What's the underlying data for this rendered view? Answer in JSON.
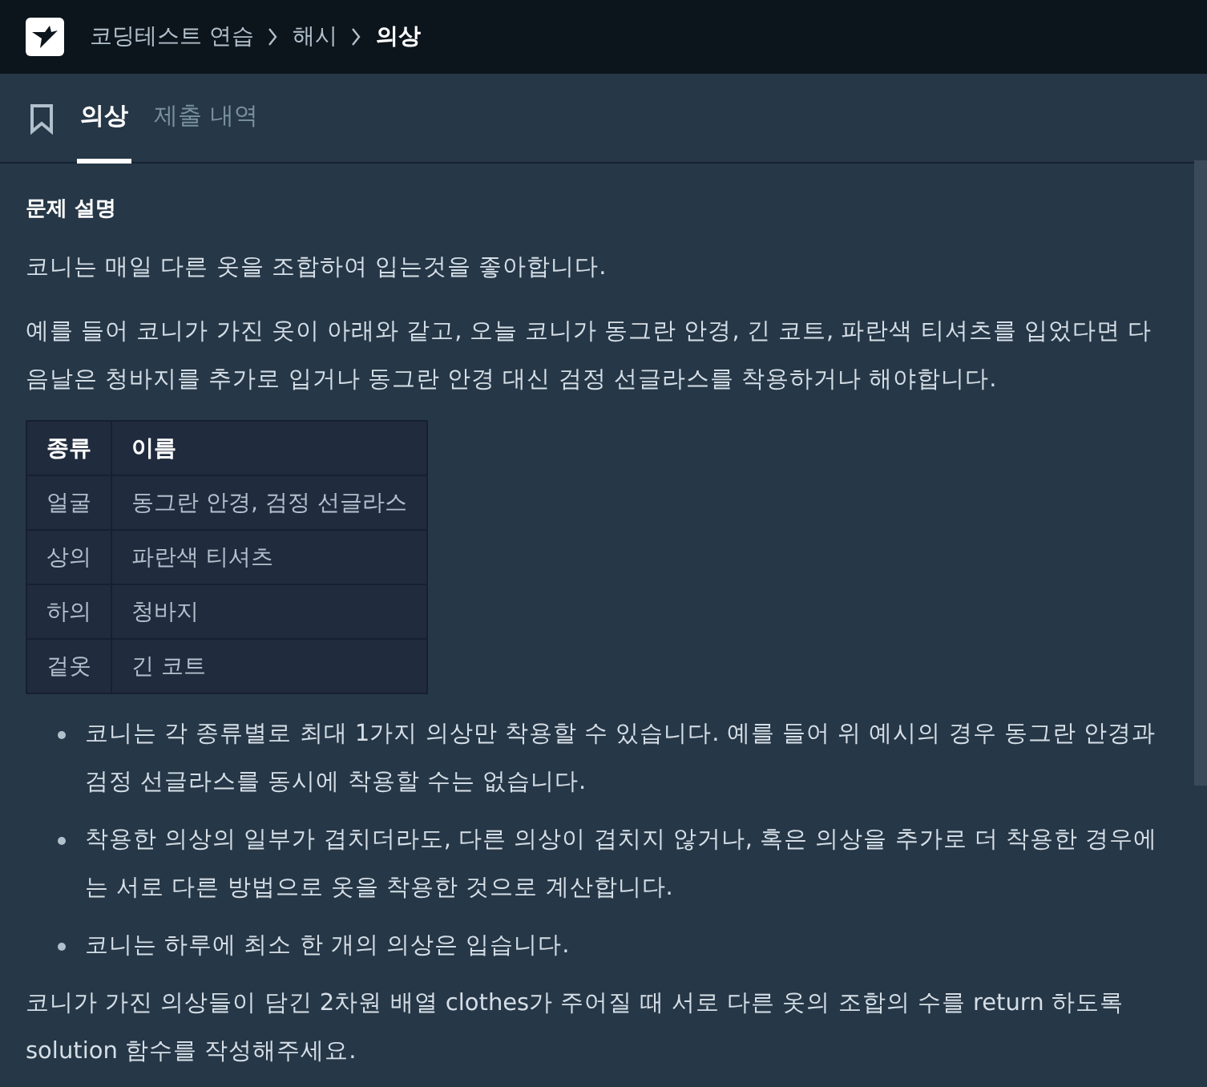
{
  "breadcrumb": [
    {
      "label": "코딩테스트 연습",
      "current": false
    },
    {
      "label": "해시",
      "current": false
    },
    {
      "label": "의상",
      "current": true
    }
  ],
  "tabs": [
    {
      "label": "의상",
      "selected": true
    },
    {
      "label": "제출 내역",
      "selected": false
    }
  ],
  "section_title": "문제 설명",
  "paragraphs": [
    "코니는 매일 다른 옷을 조합하여 입는것을 좋아합니다.",
    "예를 들어 코니가 가진 옷이 아래와 같고, 오늘 코니가 동그란 안경, 긴 코트, 파란색 티셔츠를 입었다면 다음날은 청바지를 추가로 입거나 동그란 안경 대신 검정 선글라스를 착용하거나 해야합니다."
  ],
  "table": {
    "columns": [
      "종류",
      "이름"
    ],
    "rows": [
      [
        "얼굴",
        "동그란 안경, 검정 선글라스"
      ],
      [
        "상의",
        "파란색 티셔츠"
      ],
      [
        "하의",
        "청바지"
      ],
      [
        "겉옷",
        "긴 코트"
      ]
    ]
  },
  "bullets": [
    "코니는 각 종류별로 최대 1가지 의상만 착용할 수 있습니다. 예를 들어 위 예시의 경우 동그란 안경과 검정 선글라스를 동시에 착용할 수는 없습니다.",
    "착용한 의상의 일부가 겹치더라도, 다른 의상이 겹치지 않거나, 혹은 의상을 추가로 더 착용한 경우에는 서로 다른 방법으로 옷을 착용한 것으로 계산합니다.",
    "코니는 하루에 최소 한 개의 의상은 입습니다."
  ],
  "closing": "코니가 가진 의상들이 담긴 2차원 배열 clothes가 주어질 때 서로 다른 옷의 조합의 수를 return 하도록 solution 함수를 작성해주세요."
}
